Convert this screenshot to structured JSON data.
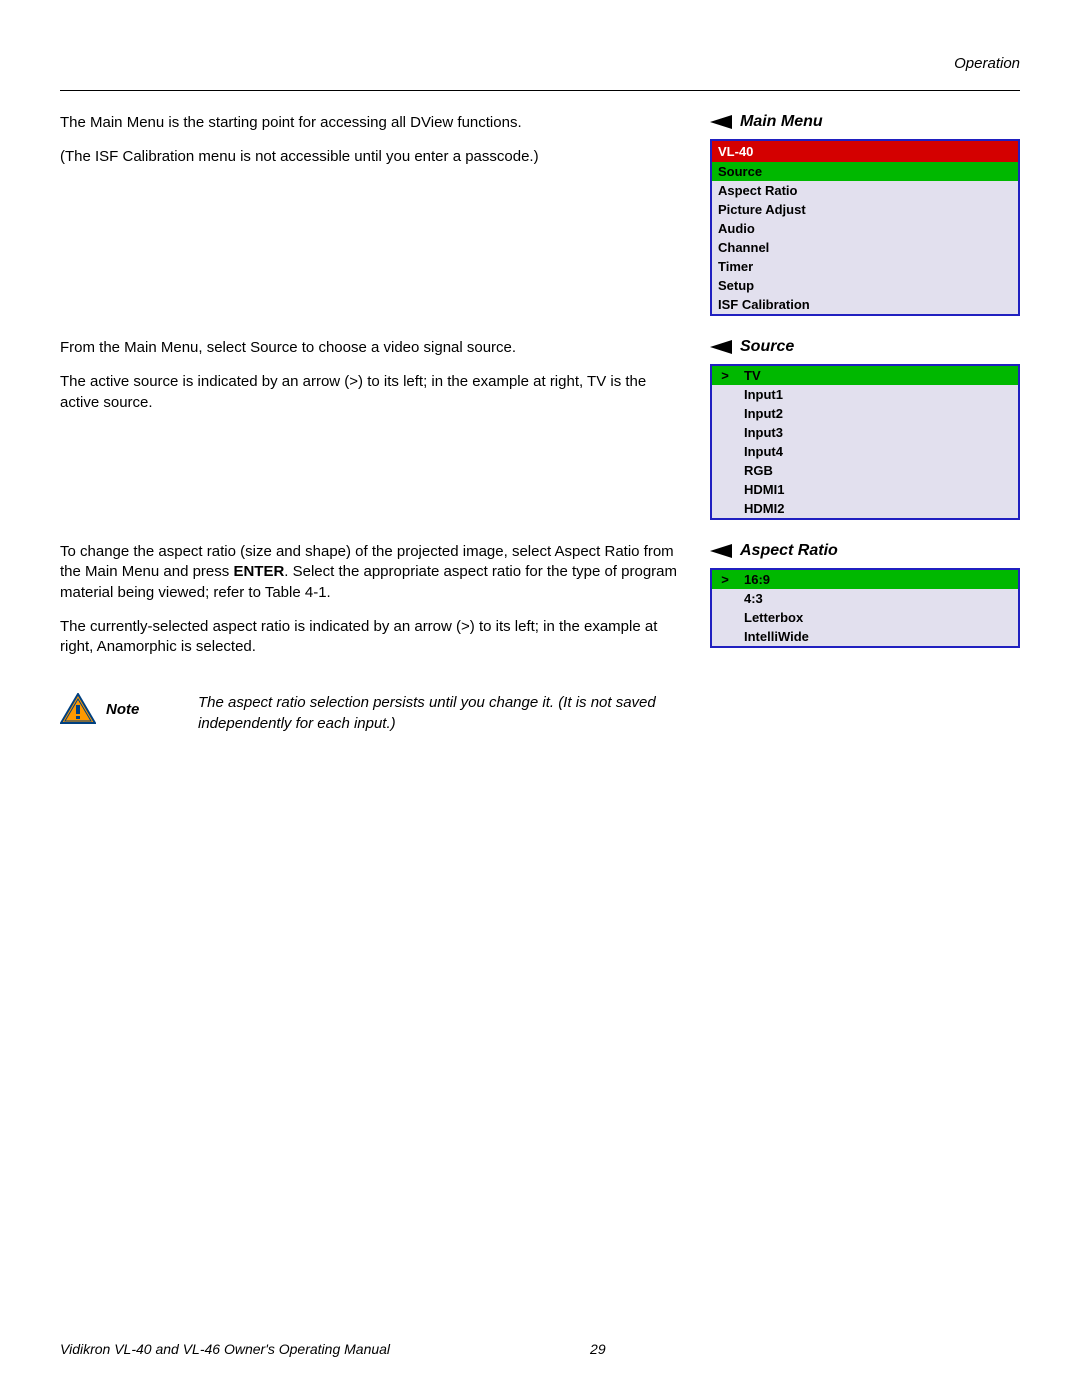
{
  "header": {
    "section": "Operation"
  },
  "mainMenuSection": {
    "heading": "Main Menu",
    "para1": "The Main Menu is the starting point for accessing all DView functions.",
    "para2": "(The ISF Calibration menu is not accessible until you enter a passcode.)",
    "menuTitle": "VL-40",
    "items": [
      "Source",
      "Aspect Ratio",
      "Picture Adjust",
      "Audio",
      "Channel",
      "Timer",
      "Setup",
      "ISF Calibration"
    ],
    "selectedIndex": 0
  },
  "sourceSection": {
    "heading": "Source",
    "para1": "From the Main Menu, select Source to choose a video signal source.",
    "para2": "The active source is indicated by an arrow (>) to its left; in the example at right, TV is the active source.",
    "items": [
      "TV",
      "Input1",
      "Input2",
      "Input3",
      "Input4",
      "RGB",
      "HDMI1",
      "HDMI2"
    ],
    "selectedIndex": 0
  },
  "aspectSection": {
    "heading": "Aspect Ratio",
    "para1_pre": "To change the aspect ratio (size and shape) of the projected image, select Aspect Ratio from the Main Menu and press ",
    "para1_bold": "ENTER",
    "para1_post": ". Select the appropriate aspect ratio for the type of program material being viewed; refer to Table 4-1.",
    "para2": "The currently-selected aspect ratio is indicated by an arrow (>) to its left; in the example at right, Anamorphic is selected.",
    "items": [
      "16:9",
      "4:3",
      "Letterbox",
      "IntelliWide"
    ],
    "selectedIndex": 0
  },
  "note": {
    "label": "Note",
    "text": "The aspect ratio selection persists until you change it. (It is not saved independently for each input.)"
  },
  "footer": {
    "title": "Vidikron VL-40 and VL-46 Owner's Operating Manual",
    "page": "29"
  }
}
